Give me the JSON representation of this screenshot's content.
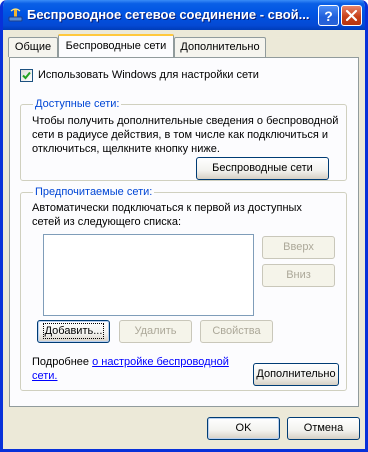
{
  "window": {
    "title": "Беспроводное сетевое соединение - свой..."
  },
  "tabs": [
    {
      "label": "Общие",
      "active": false
    },
    {
      "label": "Беспроводные сети",
      "active": true
    },
    {
      "label": "Дополнительно",
      "active": false
    }
  ],
  "use_windows_checkbox": {
    "label": "Использовать Windows для настройки сети",
    "checked": true
  },
  "available_networks": {
    "title": "Доступные сети:",
    "description_line1": "Чтобы получить дополнительные сведения о беспроводной",
    "description_line2": "сети в радиусе действия, в том числе как подключиться и",
    "description_line3": "отключиться, щелкните кнопку ниже.",
    "button_label": "Беспроводные сети"
  },
  "preferred_networks": {
    "title": "Предпочитаемые сети:",
    "description_line1": "Автоматически подключаться к первой из доступных",
    "description_line2": "сетей из следующего списка:",
    "up_button": "Вверх",
    "down_button": "Вниз",
    "add_button": "Добавить...",
    "remove_button": "Удалить",
    "properties_button": "Свойства",
    "items": []
  },
  "learn_more": {
    "prefix": "Подробнее ",
    "link_line1": "о настройке  беспроводной",
    "link_line2": "сети."
  },
  "advanced_button": "Дополнительно",
  "ok_button": "OK",
  "cancel_button": "Отмена",
  "colors": {
    "titlebar": "#0054E3",
    "group_title": "#0046D5",
    "dialog_bg": "#ECE9D8",
    "tab_highlight": "#FFC83C"
  }
}
